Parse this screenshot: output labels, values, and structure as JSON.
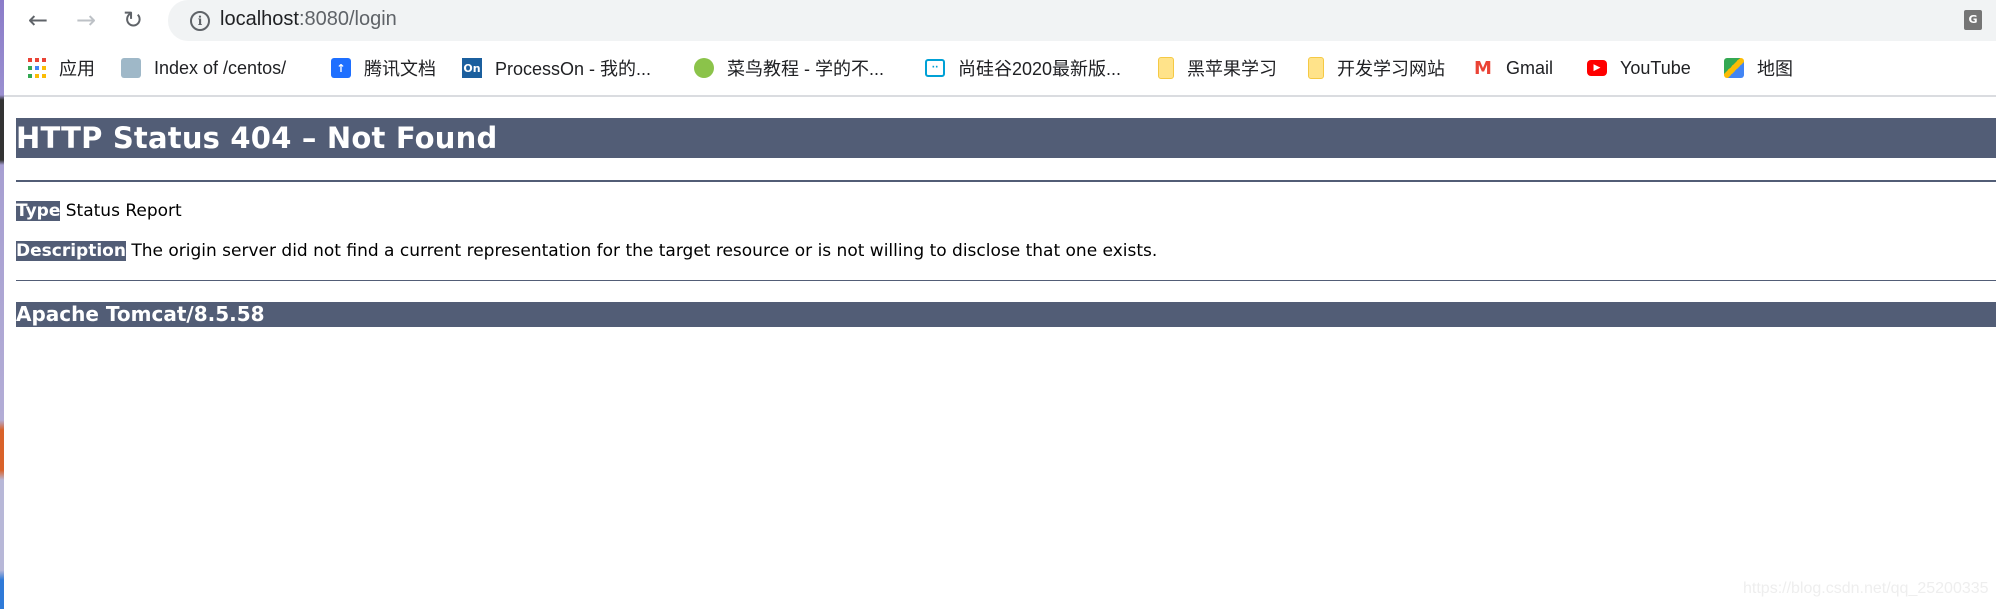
{
  "browser": {
    "url_host": "localhost",
    "url_rest": ":8080/login",
    "bookmarks": [
      {
        "label": "应用",
        "icon": "apps-grid-icon"
      },
      {
        "label": "Index of /centos/",
        "icon": "page-thumbnail-icon"
      },
      {
        "label": "腾讯文档",
        "icon": "tencent-docs-icon"
      },
      {
        "label": "ProcessOn - 我的...",
        "icon": "processon-icon"
      },
      {
        "label": "菜鸟教程 - 学的不...",
        "icon": "runoob-icon"
      },
      {
        "label": "尚硅谷2020最新版...",
        "icon": "bilibili-icon"
      },
      {
        "label": "黑苹果学习",
        "icon": "folder-icon"
      },
      {
        "label": "开发学习网站",
        "icon": "folder-icon"
      },
      {
        "label": "Gmail",
        "icon": "gmail-icon"
      },
      {
        "label": "YouTube",
        "icon": "youtube-icon"
      },
      {
        "label": "地图",
        "icon": "maps-icon"
      }
    ]
  },
  "page": {
    "title": "HTTP Status 404 – Not Found",
    "type_label": "Type",
    "type_value": "Status Report",
    "description_label": "Description",
    "description_value": "The origin server did not find a current representation for the target resource or is not willing to disclose that one exists.",
    "footer": "Apache Tomcat/8.5.58",
    "header_color": "#525d76"
  },
  "watermark": "https://blog.csdn.net/qq_25200335"
}
